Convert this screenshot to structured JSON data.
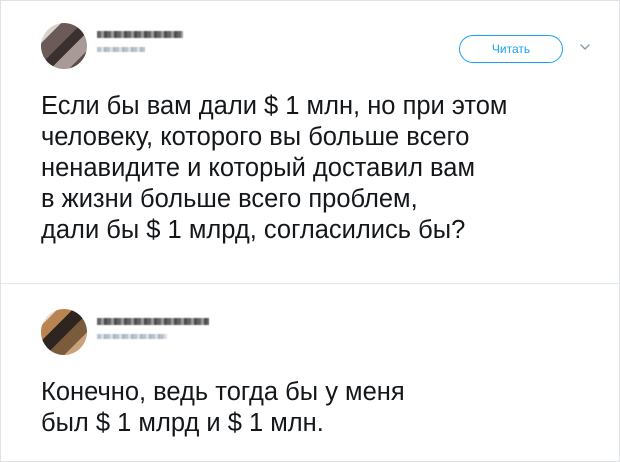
{
  "tweet1": {
    "follow_label": "Читать",
    "text": "Если бы вам дали $ 1 млн, но при этом\nчеловеку, которого вы больше всего\nненавидите и который доставил вам\nв жизни больше всего проблем,\nдали бы $ 1 млрд, согласились бы?",
    "icons": {
      "avatar": "avatar-icon",
      "menu": "chevron-down-icon"
    }
  },
  "tweet2": {
    "text": "Конечно, ведь тогда бы у меня\nбыл $ 1 млрд и $ 1 млн.",
    "icons": {
      "avatar": "avatar-icon"
    }
  },
  "colors": {
    "accent": "#1da1f2",
    "text": "#14171a",
    "border": "#e1e8ed"
  }
}
